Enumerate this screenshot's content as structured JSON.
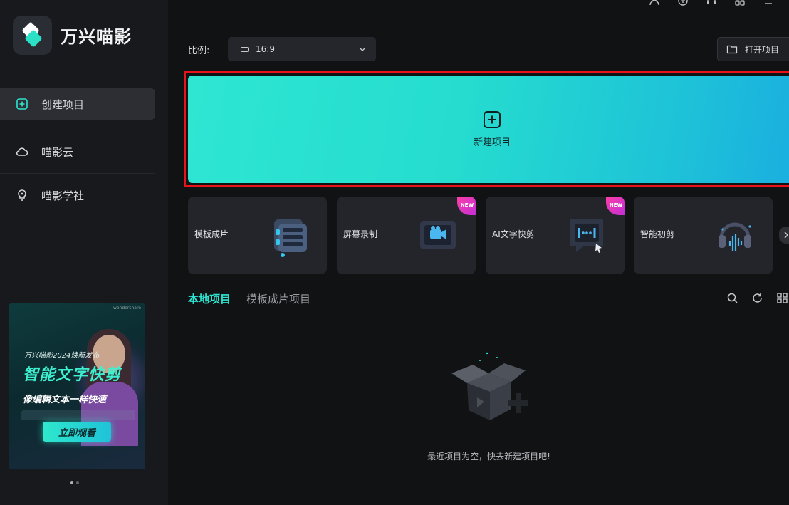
{
  "app": {
    "name": "万兴喵影"
  },
  "sidebar": {
    "items": [
      {
        "label": "创建项目",
        "icon": "create-project-icon",
        "active": true
      },
      {
        "label": "喵影云",
        "icon": "cloud-icon",
        "active": false
      },
      {
        "label": "喵影学社",
        "icon": "academy-icon",
        "active": false
      }
    ],
    "banner": {
      "brand_tag": "wondershare",
      "line1": "万兴喵影2024焕新发布",
      "headline": "智能文字快剪",
      "subline": "像编辑文本一样快速",
      "cta": "立即观看"
    },
    "carousel_dots": 2
  },
  "top_icons": [
    "user-icon",
    "cloud-upload-icon",
    "headset-icon",
    "grid-apps-icon",
    "minimize-icon"
  ],
  "ratio": {
    "label": "比例:",
    "value": "16:9"
  },
  "open_project": {
    "label": "打开项目"
  },
  "new_project": {
    "label": "新建项目"
  },
  "feature_cards": [
    {
      "label": "模板成片",
      "icon": "template-icon",
      "is_new": false
    },
    {
      "label": "屏幕录制",
      "icon": "screen-record-icon",
      "is_new": true
    },
    {
      "label": "AI文字快剪",
      "icon": "ai-text-cut-icon",
      "is_new": true
    },
    {
      "label": "智能初剪",
      "icon": "smart-cut-icon",
      "is_new": false
    }
  ],
  "new_badge": "NEW",
  "tabs": [
    {
      "label": "本地项目",
      "active": true
    },
    {
      "label": "模板成片项目",
      "active": false
    }
  ],
  "empty_state": {
    "message": "最近项目为空，快去新建项目吧!"
  },
  "colors": {
    "accent": "#2ee6d2",
    "highlight_frame": "#e8141c",
    "background": "#111214",
    "sidebar": "#18191c"
  }
}
